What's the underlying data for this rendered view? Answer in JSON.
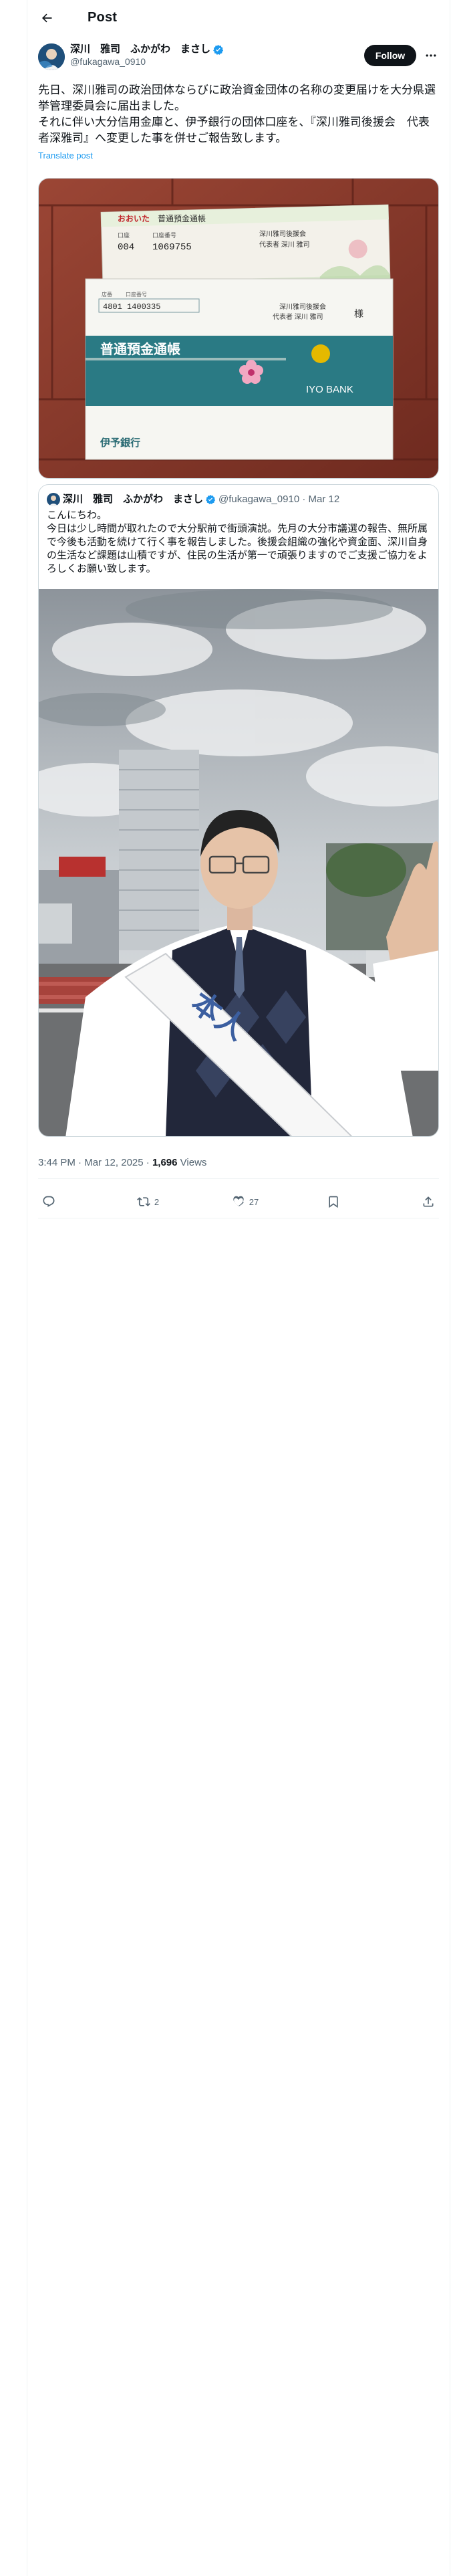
{
  "header": {
    "title": "Post"
  },
  "author": {
    "display_name": "深川　雅司　ふかがわ　まさし",
    "handle": "@fukagawa_0910",
    "follow_label": "Follow"
  },
  "post": {
    "text": "先日、深川雅司の政治団体ならびに政治資金団体の名称の変更届けを大分県選挙管理委員会に届出ました。\nそれに伴い大分信用金庫と、伊予銀行の団体口座を、『深川雅司後援会　代表者深雅司』へ変更した事を併せご報告致します。",
    "translate_label": "Translate post"
  },
  "media_passbooks": {
    "top_book": {
      "bank": "おおいた",
      "title": "普通預金通帳",
      "fields": [
        "口座",
        "口座番号"
      ],
      "number": "1069755",
      "branch": "004",
      "owner_line": "深川雅司後援会",
      "owner_sub": "代表者 深川 雅司"
    },
    "bottom_book": {
      "codes": [
        "店番",
        "口座番号"
      ],
      "number": "4801 1400335",
      "owner_line": "深川雅司後援会",
      "owner_sub": "代表者 深川 雅司",
      "stamp": "様",
      "title": "普通預金通帳",
      "bank_en": "IYO BANK",
      "bank_jp": "伊予銀行"
    }
  },
  "quote": {
    "display_name": "深川　雅司　ふかがわ　まさし",
    "handle": "@fukagawa_0910",
    "date": "Mar 12",
    "text": "こんにちわ。\n今日は少し時間が取れたので大分駅前で街頭演説。先月の大分市議選の報告、無所属で今後も活動を続けて行く事を報告しました。後援会組織の強化や資金面、深川自身の生活など課題は山積ですが、住民の生活が第一で頑張りますのでご支援ご協力をよろしくお願い致します。",
    "photo": {
      "sash_text": "本人"
    }
  },
  "meta": {
    "time": "3:44 PM",
    "date": "Mar 12, 2025",
    "views_count": "1,696",
    "views_label": "Views",
    "separator": " · "
  },
  "actions": {
    "replies": "",
    "reposts": "2",
    "likes": "27",
    "bookmarks": ""
  },
  "colors": {
    "follow_bg": "#0f1419",
    "link": "#1d9bf0",
    "verified": "#1d9bf0",
    "muted": "#536471",
    "iyo_teal": "#2a7a84",
    "brick": "#8f3a2c"
  }
}
